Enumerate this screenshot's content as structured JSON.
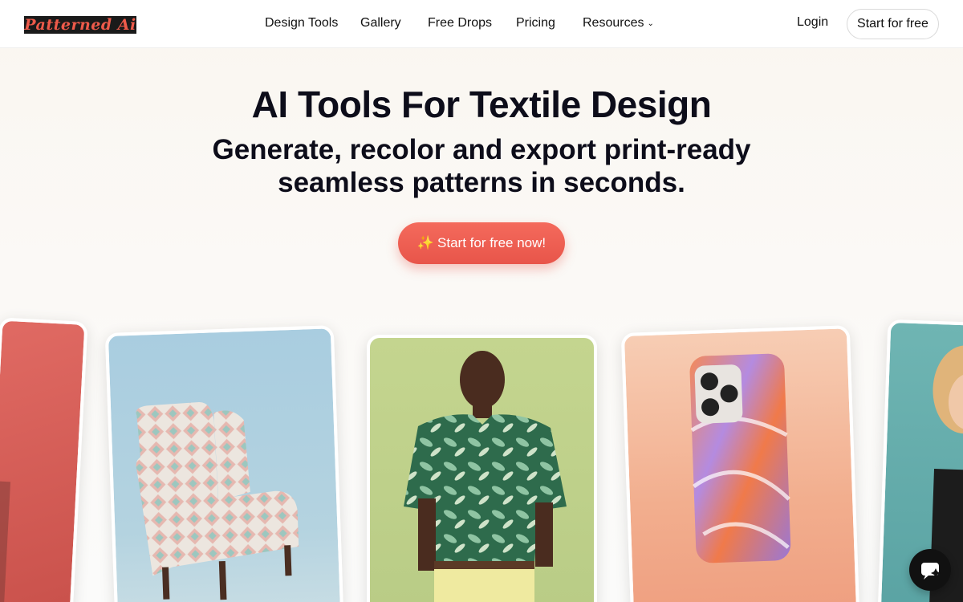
{
  "brand": {
    "logo_text": "Patterned Ai",
    "accent": "#ee5a4a"
  },
  "nav": {
    "items": [
      {
        "label": "Design Tools"
      },
      {
        "label": "Gallery"
      },
      {
        "label": "Free Drops"
      },
      {
        "label": "Pricing"
      },
      {
        "label": "Resources",
        "chevron": "chevron-down-icon"
      }
    ],
    "login_label": "Login",
    "start_label": "Start for free"
  },
  "hero": {
    "title": "AI Tools For Textile Design",
    "subtitle": "Generate, recolor and export print-ready seamless patterns in seconds.",
    "cta_label": "Start for free now!",
    "cta_icon": "sparkle-icon",
    "cta_color": "#ef5f51"
  },
  "showcase": {
    "cards": [
      {
        "subject": "model-photo"
      },
      {
        "subject": "armchair-photo"
      },
      {
        "subject": "shirt-model-photo"
      },
      {
        "subject": "phone-case-photo"
      },
      {
        "subject": "woman-photo"
      }
    ]
  },
  "chat": {
    "icon": "chat-sparkle-icon"
  }
}
